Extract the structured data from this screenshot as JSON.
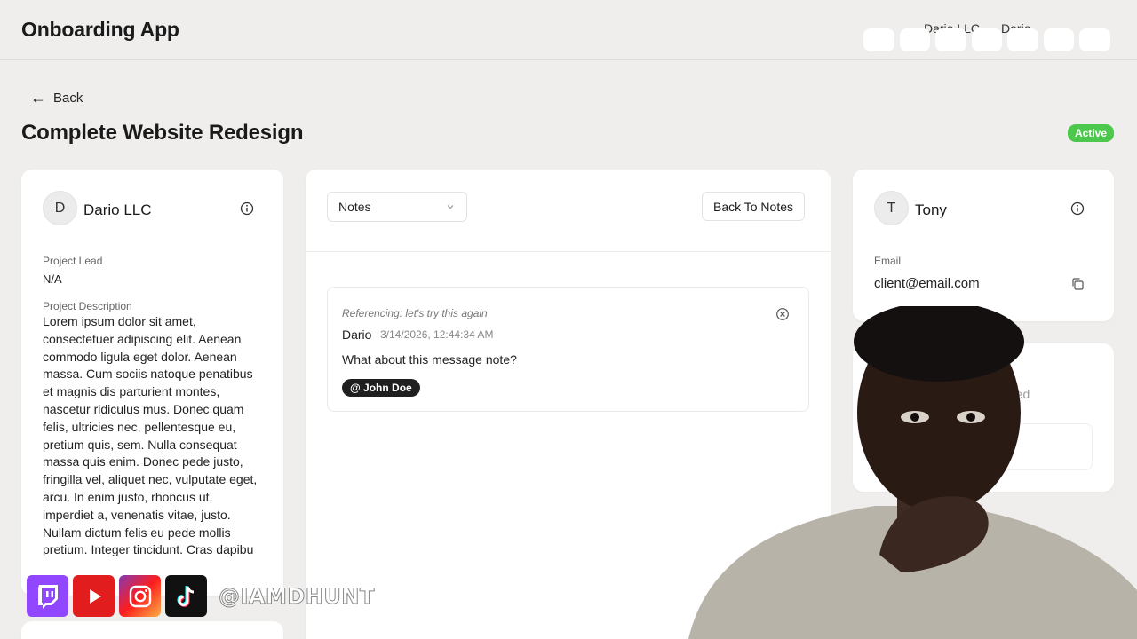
{
  "app": {
    "title": "Onboarding App"
  },
  "header": {
    "org_menu": "Dario LLC",
    "user_menu": "Dario"
  },
  "nav": {
    "back_label": "Back"
  },
  "project": {
    "title": "Complete Website Redesign",
    "status": "Active",
    "status_color": "#4cc94c"
  },
  "client_card": {
    "avatar": "D",
    "name": "Dario LLC",
    "lead_label": "Project Lead",
    "lead_value": "N/A",
    "desc_label": "Project Description",
    "desc_text": "Lorem ipsum dolor sit amet, consectetuer adipiscing elit. Aenean commodo ligula eget dolor. Aenean massa. Cum sociis natoque penatibus et magnis dis parturient montes, nascetur ridiculus mus. Donec quam felis, ultricies nec, pellentesque eu, pretium quis, sem. Nulla consequat massa quis enim. Donec pede justo, fringilla vel, aliquet nec, vulputate eget, arcu. In enim justo, rhoncus ut, imperdiet a, venenatis vitae, justo. Nullam dictum felis eu pede mollis pretium. Integer tincidunt. Cras dapibu"
  },
  "notes_panel": {
    "select_value": "Notes",
    "back_button": "Back To Notes",
    "note": {
      "reference": "Referencing: let's try this again",
      "author": "Dario",
      "timestamp": "3/14/2026, 12:44:34 AM",
      "message": "What about this message note?",
      "mention": "@ John Doe"
    }
  },
  "contact_card": {
    "avatar": "T",
    "name": "Tony",
    "email_label": "Email",
    "email": "client@email.com"
  },
  "second_card": {
    "partial_text": "eted"
  },
  "overlay": {
    "handle": "@IAMDHUNT",
    "socials": [
      "twitch-icon",
      "youtube-icon",
      "instagram-icon",
      "tiktok-icon"
    ]
  }
}
